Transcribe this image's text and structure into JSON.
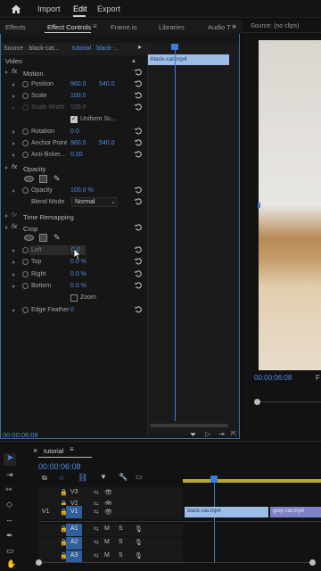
{
  "topbar": {
    "items": [
      "Import",
      "Edit",
      "Export"
    ]
  },
  "tabs": [
    "Effects",
    "Effect Controls",
    "Frame.io",
    "Libraries",
    "Audio T",
    "Source: (no clips)"
  ],
  "source": {
    "left": "Source · black-cat...",
    "right": "tutorial · black-..."
  },
  "clip": {
    "name": "black-cat.mp4"
  },
  "sections": {
    "video": "Video",
    "motion": "Motion",
    "position": {
      "label": "Position",
      "x": "960.0",
      "y": "540.0"
    },
    "scale": {
      "label": "Scale",
      "value": "100.0"
    },
    "scale_width": {
      "label": "Scale Width",
      "value": "100.0"
    },
    "uniform": "Uniform Sc...",
    "rotation": {
      "label": "Rotation",
      "value": "0.0"
    },
    "anchor": {
      "label": "Anchor Point",
      "x": "960.0",
      "y": "540.0"
    },
    "flicker": {
      "label": "Anti-flicker...",
      "value": "0.00"
    },
    "opacity": "Opacity",
    "opacity_row": {
      "label": "Opacity",
      "value": "100.0 %"
    },
    "blend": {
      "label": "Blend Mode",
      "value": "Normal"
    },
    "time_remap": "Time Remapping",
    "crop": "Crop",
    "left": {
      "label": "Left",
      "value": "0.0"
    },
    "top": {
      "label": "Top",
      "value": "0.0 %"
    },
    "right": {
      "label": "Right",
      "value": "0.0 %"
    },
    "bottom": {
      "label": "Bottom",
      "value": "0.0 %"
    },
    "zoom": "Zoom",
    "edge": {
      "label": "Edge Feather",
      "value": "0"
    }
  },
  "ec_timecode": "00:00:06:08",
  "program": {
    "timecode": "00:00:06:08",
    "right": "F"
  },
  "timeline": {
    "tab": "tutorial",
    "timecode": "00:00:06:08",
    "tracks": [
      {
        "name": "V3",
        "target": ""
      },
      {
        "name": "V2",
        "target": ""
      },
      {
        "name": "V1",
        "target": "V1"
      },
      {
        "name": "A1",
        "target": "A1"
      },
      {
        "name": "A2",
        "target": "A2"
      },
      {
        "name": "A3",
        "target": "A3"
      }
    ],
    "clips": [
      "black-cat.mp4",
      "grey-cat.mp4"
    ],
    "ms": [
      "M",
      "S"
    ]
  },
  "colors": {
    "accent": "#3e7dd6",
    "clip_video": "#7d83c9",
    "clip_selected": "#9cbde7"
  }
}
